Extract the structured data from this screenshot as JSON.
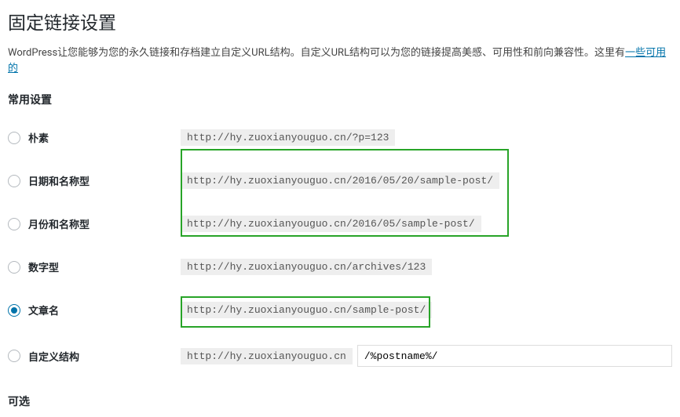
{
  "page": {
    "title": "固定链接设置",
    "descriptionPrefix": "WordPress让您能够为您的永久链接和存档建立自定义URL结构。自定义URL结构可以为您的链接提高美感、可用性和前向兼容性。这里有",
    "descriptionLink": "一些可用的",
    "sectionTitle": "常用设置",
    "footerHeading": "可选"
  },
  "options": {
    "plain": {
      "label": "朴素",
      "url": "http://hy.zuoxianyouguo.cn/?p=123"
    },
    "dayname": {
      "label": "日期和名称型",
      "url": "http://hy.zuoxianyouguo.cn/2016/05/20/sample-post/"
    },
    "month": {
      "label": "月份和名称型",
      "url": "http://hy.zuoxianyouguo.cn/2016/05/sample-post/"
    },
    "numeric": {
      "label": "数字型",
      "url": "http://hy.zuoxianyouguo.cn/archives/123"
    },
    "postname": {
      "label": "文章名",
      "url": "http://hy.zuoxianyouguo.cn/sample-post/"
    },
    "custom": {
      "label": "自定义结构",
      "base": "http://hy.zuoxianyouguo.cn",
      "value": "/%postname%/"
    }
  }
}
